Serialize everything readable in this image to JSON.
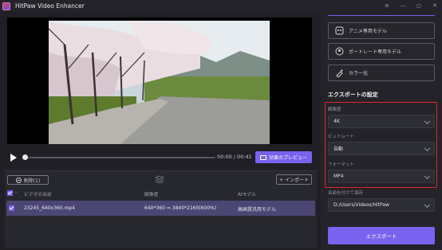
{
  "app": {
    "title": "HitPaw Video Enhancer"
  },
  "window_controls": [
    "≡",
    "—",
    "◻",
    "✕"
  ],
  "player": {
    "time": "00:00 / 00:41",
    "preview_button": "効果のプレビュー",
    "progress": 0.0
  },
  "list": {
    "delete_button": "削除(1)",
    "import_button": "+ インポート",
    "columns": [
      "ビデオの名前",
      "解像度",
      "AIモデル"
    ],
    "rows": [
      {
        "name": "23245_640x360.mp4",
        "resolution": "640*360  ⇒  3840*2160(600%)",
        "model": "高画質汎用モデル"
      }
    ]
  },
  "side": {
    "models": [
      {
        "label": "アニメ専用モデル",
        "icon": "anime-icon"
      },
      {
        "label": "ポートレート専用モデル",
        "icon": "portrait-icon"
      },
      {
        "label": "カラー化",
        "icon": "colorize-icon"
      }
    ],
    "export_settings_title": "エクスポートの設定",
    "resolution_label": "解像度",
    "resolution_value": "4K",
    "bitrate_label": "ビットレート",
    "bitrate_value": "自動",
    "format_label": "フォーマット",
    "format_value": "MP4",
    "save_label": "名前を付けて保存",
    "save_path": "D:/Users/Videos/HitPaw",
    "export_button": "エクスポート"
  },
  "colors": {
    "accent": "#7a62f0",
    "highlight": "#e02828",
    "row_selected": "#4b4673"
  }
}
